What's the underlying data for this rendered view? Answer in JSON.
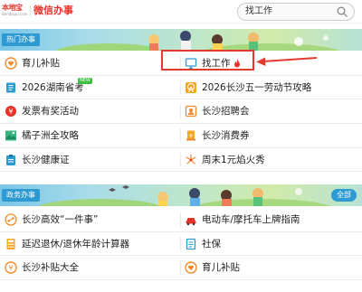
{
  "header": {
    "logo_text": "本地宝",
    "logo_sub": "Bendibao.com",
    "site_name": "微信办事",
    "search_value": "找工作"
  },
  "sections": [
    {
      "tab_label": "热门办事",
      "items": [
        {
          "label": "育儿补贴",
          "icon": "heart-coin-icon"
        },
        {
          "label": "找工作",
          "icon": "monitor-icon",
          "hot": true
        },
        {
          "label": "2026湖南省考",
          "icon": "book-icon",
          "badge": "NEW"
        },
        {
          "label": "2026长沙五一劳动节攻略",
          "icon": "ferris-wheel-icon"
        },
        {
          "label": "发票有奖活动",
          "icon": "coin-icon"
        },
        {
          "label": "长沙招聘会",
          "icon": "id-card-icon"
        },
        {
          "label": "橘子洲全攻略",
          "icon": "landscape-icon"
        },
        {
          "label": "长沙消费券",
          "icon": "coupon-icon"
        },
        {
          "label": "长沙健康证",
          "icon": "clipboard-icon"
        },
        {
          "label": "周末1元焰火秀",
          "icon": "fireworks-icon"
        }
      ]
    },
    {
      "tab_label": "政务办事",
      "more_label": "全部",
      "items": [
        {
          "label": "长沙高效“一件事”",
          "icon": "link-icon"
        },
        {
          "label": "电动车/摩托车上牌指南",
          "icon": "car-icon"
        },
        {
          "label": "延迟退休/退休年龄计算器",
          "icon": "calculator-icon"
        },
        {
          "label": "社保",
          "icon": "document-icon"
        },
        {
          "label": "长沙补贴大全",
          "icon": "coin-icon"
        },
        {
          "label": "育儿补贴",
          "icon": "heart-coin-icon"
        }
      ]
    }
  ],
  "colors": {
    "brand_red": "#e5332a",
    "tab_blue": "#2d9ad2",
    "highlight": "#e33b2f"
  }
}
